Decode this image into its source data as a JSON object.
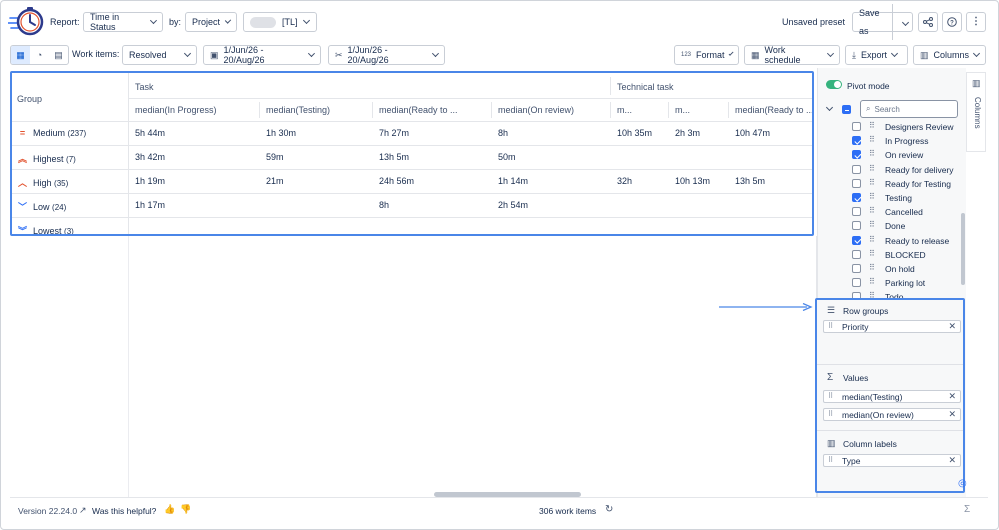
{
  "header": {
    "report_label": "Report:",
    "report_value": "Time in Status",
    "by_label": "by:",
    "by_value": "Project",
    "project_value": "[TL]",
    "preset_status": "Unsaved preset",
    "save_as": "Save as"
  },
  "toolbar": {
    "work_items_label": "Work items:",
    "work_items_value": "Resolved",
    "date_range_1": "1/Jun/26 - 20/Aug/26",
    "date_range_2": "1/Jun/26 - 20/Aug/26",
    "format_label": "Format",
    "format_icon_text": "123",
    "schedule_label": "Work schedule",
    "export_label": "Export",
    "columns_label": "Columns"
  },
  "grid": {
    "group_header": "Group",
    "column_groups": [
      "Task",
      "Technical task"
    ],
    "columns": [
      "median(In Progress)",
      "median(Testing)",
      "median(Ready to ...",
      "median(On review)",
      "m...",
      "m...",
      "median(Ready to ..."
    ],
    "rows": [
      {
        "group": "Medium",
        "count": "(237)",
        "icon": "equals-icon",
        "color": "#e2522e",
        "cells": [
          "5h 44m",
          "1h 30m",
          "7h 27m",
          "8h",
          "10h 35m",
          "2h 3m",
          "10h 47m"
        ]
      },
      {
        "group": "Highest",
        "count": "(7)",
        "icon": "double-chevron-up-icon",
        "color": "#e2522e",
        "cells": [
          "3h 42m",
          "59m",
          "13h 5m",
          "50m",
          "",
          "",
          ""
        ]
      },
      {
        "group": "High",
        "count": "(35)",
        "icon": "chevron-up-icon",
        "color": "#e2522e",
        "cells": [
          "1h 19m",
          "21m",
          "24h 56m",
          "1h 14m",
          "32h",
          "10h 13m",
          "13h 5m"
        ]
      },
      {
        "group": "Low",
        "count": "(24)",
        "icon": "chevron-down-icon",
        "color": "#2d6ef5",
        "cells": [
          "1h 17m",
          "",
          "8h",
          "2h 54m",
          "",
          "",
          ""
        ]
      },
      {
        "group": "Lowest",
        "count": "(3)",
        "icon": "double-chevron-down-icon",
        "color": "#2d6ef5",
        "cells": [
          "",
          "",
          "",
          "",
          "",
          "",
          ""
        ]
      }
    ]
  },
  "panel": {
    "pivot_label": "Pivot mode",
    "search_placeholder": "Search",
    "statuses": [
      {
        "label": "Designers Review",
        "checked": false
      },
      {
        "label": "In Progress",
        "checked": true
      },
      {
        "label": "On review",
        "checked": true
      },
      {
        "label": "Ready for delivery",
        "checked": false
      },
      {
        "label": "Ready for Testing",
        "checked": false
      },
      {
        "label": "Testing",
        "checked": true
      },
      {
        "label": "Cancelled",
        "checked": false
      },
      {
        "label": "Done",
        "checked": false
      },
      {
        "label": "Ready to release",
        "checked": true
      },
      {
        "label": "BLOCKED",
        "checked": false
      },
      {
        "label": "On hold",
        "checked": false
      },
      {
        "label": "Parking lot",
        "checked": false
      },
      {
        "label": "Todo",
        "checked": false
      }
    ],
    "side_tab": "Columns",
    "row_groups_title": "Row groups",
    "row_groups": [
      "Priority"
    ],
    "values_title": "Values",
    "values": [
      "median(Testing)",
      "median(On review)"
    ],
    "column_labels_title": "Column labels",
    "column_labels": [
      "Type"
    ]
  },
  "footer": {
    "version": "Version 22.24.0",
    "helpful": "Was this helpful?",
    "count": "306 work items"
  }
}
